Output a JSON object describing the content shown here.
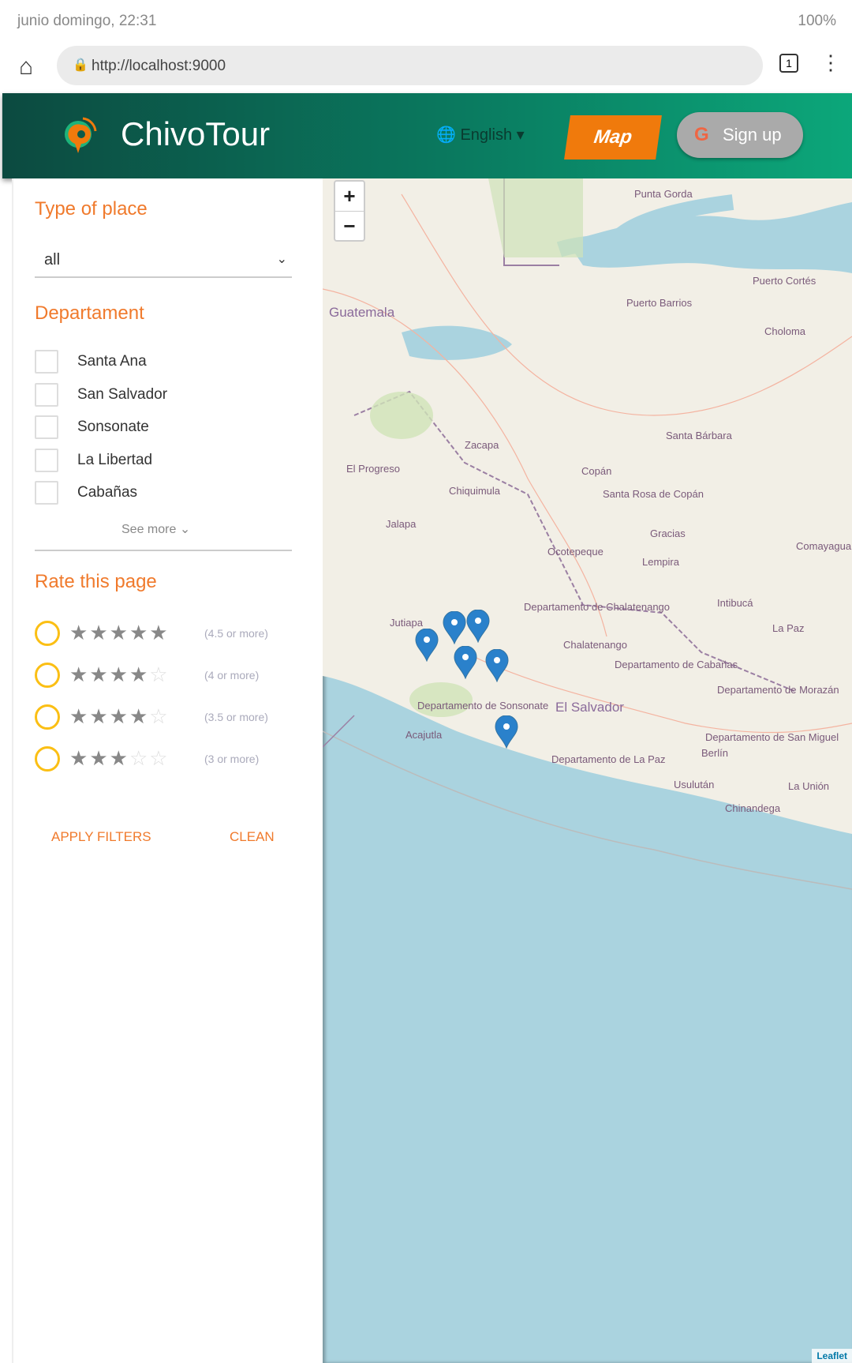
{
  "status_bar": {
    "left": "junio domingo, 22:31",
    "right": "100%"
  },
  "browser": {
    "url": "http://localhost:9000",
    "tab_count": "1"
  },
  "header": {
    "brand": "ChivoTour",
    "language": "English",
    "map_button": "Map",
    "signup_button": "Sign up",
    "google_glyph": "G"
  },
  "sidebar": {
    "type_title": "Type of place",
    "type_value": "all",
    "dept_title": "Departament",
    "departments": [
      "Santa Ana",
      "San Salvador",
      "Sonsonate",
      "La Libertad",
      "Cabañas"
    ],
    "see_more": "See more",
    "rate_title": "Rate this page",
    "ratings": [
      {
        "stars": 4.5,
        "label": "(4.5 or more)"
      },
      {
        "stars": 4,
        "label": "(4 or more)"
      },
      {
        "stars": 3.5,
        "label": "(3.5 or more)"
      },
      {
        "stars": 3,
        "label": "(3 or more)"
      }
    ],
    "apply": "APPLY FILTERS",
    "clean": "CLEAN"
  },
  "map": {
    "zoom_in": "+",
    "zoom_out": "−",
    "labels": [
      "Guatemala",
      "Puerto Barrios",
      "Punta Gorda",
      "Puerto Cortés",
      "Choloma",
      "Santa Bárbara",
      "Zacapa",
      "El Progreso",
      "Chiquimula",
      "Jalapa",
      "Copán",
      "Santa Rosa de Copán",
      "Ocotepeque",
      "Gracias",
      "Lempira",
      "Intibucá",
      "La Paz",
      "Chalatenango",
      "Departamento de Chalatenango",
      "Departamento de Cabañas",
      "Departamento de Morazán",
      "Departamento de San Miguel",
      "Departamento de La Paz",
      "Departamento de Sonsonate",
      "El Salvador",
      "Acajutla",
      "Berlín",
      "Usulután",
      "La Unión",
      "Chinandega",
      "Comayagua",
      "Jutiapa"
    ],
    "attribution": "Leaflet"
  }
}
